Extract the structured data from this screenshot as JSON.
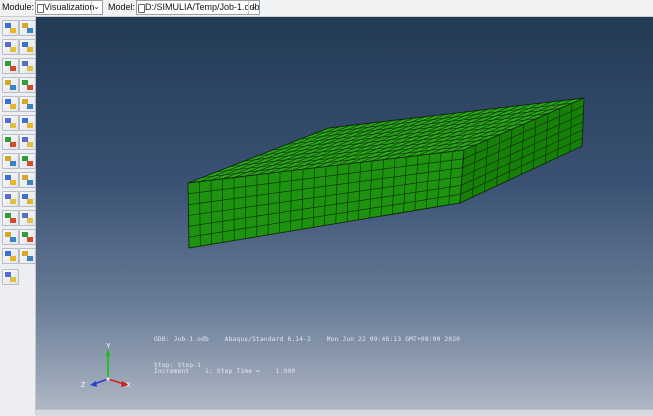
{
  "context_bar": {
    "module_label": "Module:",
    "module_value": "Visualization",
    "model_label": "Model:",
    "model_value": "D:/SIMULIA/Temp/Job-1.odb"
  },
  "viewport": {
    "odb_line": "ODB: Job-1.odb    Abaqus/Standard 6.14-2    Mon Jun 22 09:46:13 GMT+08:00 2020",
    "step_line": "Step: Step-1",
    "increment_line": "Increment    1: Step Time =    1.000",
    "triad": {
      "y": "Y",
      "z": "Z",
      "x": "X"
    }
  },
  "colors": {
    "mesh_top": "#2aa61a",
    "mesh_front": "#1e9310",
    "mesh_side": "#178009",
    "edge": "#0c2a08"
  },
  "toolbox_icons": [
    "result-tools-icon",
    "common-options-icon",
    "plot-undeformed-icon",
    "plot-deformed-icon",
    "plot-contours-icon",
    "plot-symbols-icon",
    "plot-material-icon",
    "plot-overlay-icon",
    "animate-scale-icon",
    "animate-time-icon",
    "animate-harmonic-icon",
    "animation-options-icon",
    "view-cut-icon",
    "query-icon",
    "xy-data-manager-icon",
    "xy-plot-icon",
    "path-icon",
    "stream-icon",
    "display-group-icon",
    "color-code-icon",
    "free-body-icon",
    "report-icon",
    "probe-icon",
    "sketch-icon",
    "create-field-icon",
    "field-output-icon",
    "tools-wrench-icon"
  ]
}
